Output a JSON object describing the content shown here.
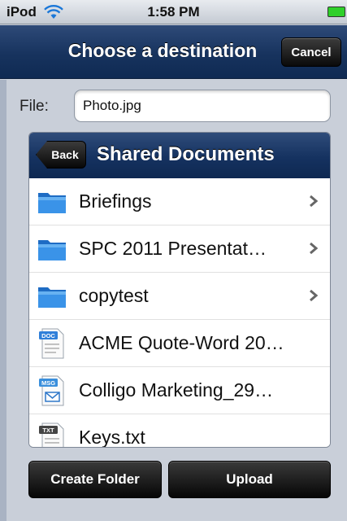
{
  "status_bar": {
    "carrier": "iPod",
    "time": "1:58 PM",
    "wifi_icon": "wifi-icon",
    "battery_icon": "battery-icon",
    "battery_color": "#2fd02a"
  },
  "nav": {
    "title": "Choose a destination",
    "cancel_label": "Cancel"
  },
  "file": {
    "label": "File:",
    "value": "Photo.jpg"
  },
  "browser": {
    "back_label": "Back",
    "title": "Shared Documents",
    "items": [
      {
        "label": "Briefings",
        "type": "folder",
        "icon": "folder-icon",
        "chevron": true
      },
      {
        "label": "SPC 2011 Presentat…",
        "type": "folder",
        "icon": "folder-icon",
        "chevron": true
      },
      {
        "label": "copytest",
        "type": "folder",
        "icon": "folder-icon",
        "chevron": true
      },
      {
        "label": "ACME Quote-Word 20…",
        "type": "doc",
        "icon": "doc-file-icon",
        "badge": "DOC",
        "chevron": false
      },
      {
        "label": "Colligo Marketing_29…",
        "type": "msg",
        "icon": "msg-file-icon",
        "badge": "MSG",
        "chevron": false
      },
      {
        "label": "Keys.txt",
        "type": "txt",
        "icon": "txt-file-icon",
        "badge": "TXT",
        "chevron": false
      }
    ]
  },
  "actions": {
    "create_folder_label": "Create Folder",
    "upload_label": "Upload"
  },
  "colors": {
    "nav_blue": "#17335e",
    "button_black": "#0a0a0a",
    "background": "#c9cfd9"
  }
}
